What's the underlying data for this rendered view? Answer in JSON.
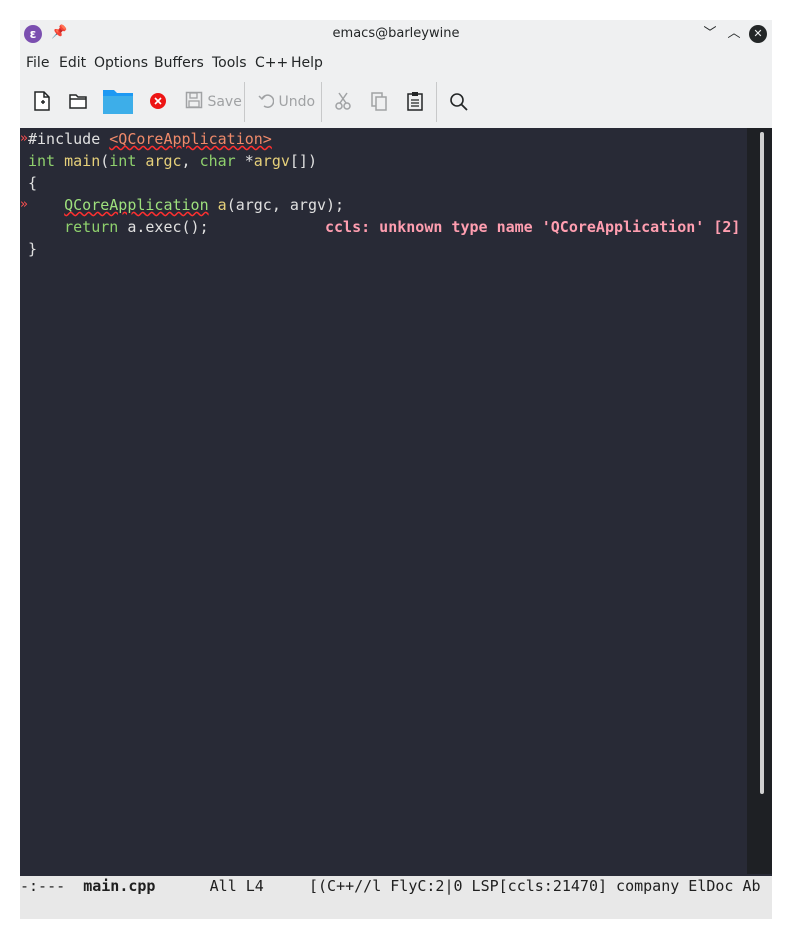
{
  "window": {
    "title": "emacs@barleywine",
    "logo": "emacs-logo-icon"
  },
  "titlebar": {
    "minimize": "﹀",
    "maximize": "︿",
    "close": "✕"
  },
  "menubar": {
    "items": [
      "File",
      "Edit",
      "Options",
      "Buffers",
      "Tools",
      "C++",
      "Help"
    ]
  },
  "toolbar": {
    "save_label": "Save",
    "undo_label": "Undo"
  },
  "code": {
    "l1_a": "#include ",
    "l1_b": "<QCoreApplication>",
    "l2_a": "int",
    "l2_b": " ",
    "l2_c": "main",
    "l2_d": "(",
    "l2_e": "int",
    "l2_f": " ",
    "l2_g": "argc",
    "l2_h": ", ",
    "l2_i": "char",
    "l2_j": " *",
    "l2_k": "argv",
    "l2_l": "[])",
    "l3": "{",
    "l4_a": "    ",
    "l4_b": "QCoreApplication",
    "l4_c": " ",
    "l4_d": "a",
    "l4_e": "(argc, argv);",
    "l5_a": "    ",
    "l5_b": "return",
    "l5_c": " a.exec();",
    "l6": "}"
  },
  "diagnostic": "ccls: unknown type name 'QCoreApplication' [2]",
  "modeline": {
    "status": "-:---  ",
    "buffer": "main.cpp",
    "position": "      All L4     ",
    "modes": "[(C++//l FlyC:2|0 LSP[ccls:21470] company ElDoc Ab"
  },
  "colors": {
    "background": "#282a36",
    "keyword": "#8fd16d",
    "function": "#e6d07a",
    "error": "#ff3030",
    "diagnostic": "#ff9eb0"
  }
}
